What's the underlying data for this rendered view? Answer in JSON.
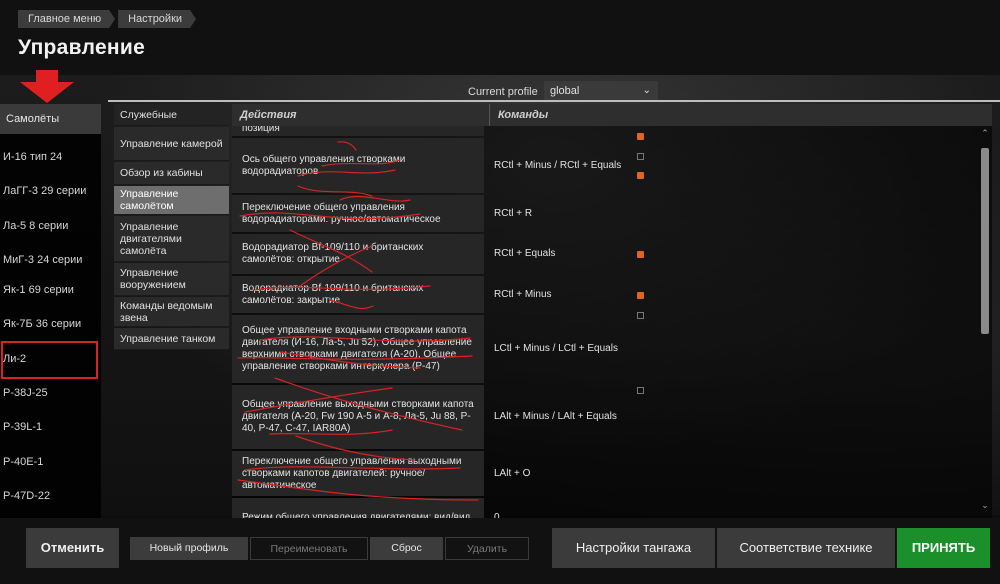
{
  "breadcrumb": [
    "Главное меню",
    "Настройки"
  ],
  "page_title": "Управление",
  "profile": {
    "label": "Current profile",
    "value": "global"
  },
  "aircraft": {
    "header": "Самолёты",
    "items": [
      "И-16 тип 24",
      "ЛаГГ-3 29 серии",
      "Ла-5 8 серии",
      "МиГ-3 24 серии",
      "Як-1 69 серии",
      "Як-7Б 36 серии",
      "Ли-2",
      "P-38J-25",
      "P-39L-1",
      "P-40E-1",
      "P-47D-22"
    ],
    "highlighted": "Ли-2"
  },
  "categories": [
    "Служебные",
    "Управление камерой",
    "Обзор из кабины",
    "Управление самолётом",
    "Управление двигателями самолёта",
    "Управление вооружением",
    "Команды ведомым звена",
    "Управление танком"
  ],
  "active_category": "Управление самолётом",
  "table": {
    "headers": {
      "actions": "Действия",
      "commands": "Команды"
    },
    "partial_top": "позиция",
    "rows": [
      {
        "action": "Ось общего управления створками водорадиаторов",
        "command": "RCtl + Minus / RCtl + Equals"
      },
      {
        "action": "Переключение общего управления водорадиаторами: ручное/автоматическое",
        "command": "RCtl + R"
      },
      {
        "action": "Водорадиатор Bf-109/110 и британских самолётов: открытие",
        "command": "RCtl + Equals"
      },
      {
        "action": "Водорадиатор Bf-109/110 и британских самолётов: закрытие",
        "command": "RCtl + Minus"
      },
      {
        "action": "Общее управление входными створками капота двигателя (И-16, Ла-5, Ju 52), Общее управление верхними створками двигателя (A-20), Общее управление створками интеркулера (P-47)",
        "command": "LCtl + Minus / LCtl + Equals"
      },
      {
        "action": "Общее управление выходными створками капота двигателя (A-20, Fw 190 A-5 и A-8, Ла-5, Ju 88, P-40, P-47, C-47, IAR80A)",
        "command": "LAlt + Minus / LAlt + Equals"
      },
      {
        "action": "Переключение общего управления выходными створками капотов двигателей: ручное/автоматическое",
        "command": "LAlt + O"
      },
      {
        "action": "Режим общего управления двигателями: вид/вид",
        "command": "0"
      }
    ]
  },
  "footer": {
    "cancel": "Отменить",
    "new_profile": "Новый профиль",
    "rename": "Переименовать",
    "reset": "Сброс",
    "delete": "Удалить",
    "pitch_settings": "Настройки тангажа",
    "tech_match": "Соответствие технике",
    "accept": "ПРИНЯТЬ"
  },
  "colors": {
    "accent_green": "#1a8f2a",
    "annotation_red": "#d42424",
    "binding_icon_orange": "#e0651e"
  }
}
